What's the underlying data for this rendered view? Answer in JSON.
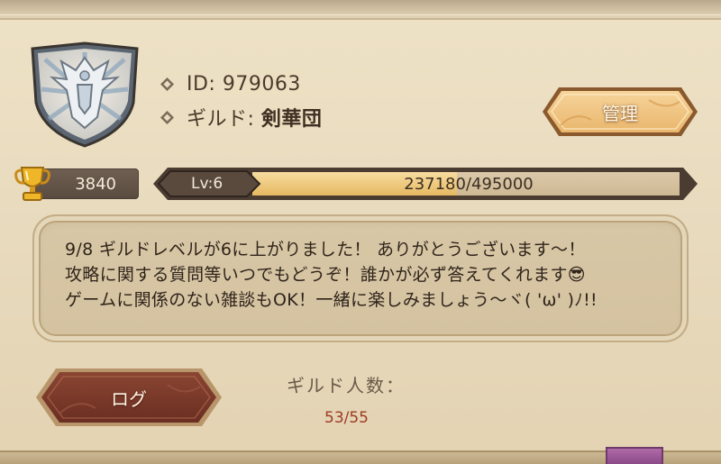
{
  "guild": {
    "id_label": "ID: 979063",
    "guild_prefix": "ギルド: ",
    "guild_name": "剣華団",
    "emblem_icon": "winged-helmet-shield-emblem"
  },
  "buttons": {
    "manage_label": "管理",
    "log_label": "ログ"
  },
  "trophy": {
    "icon": "trophy-icon",
    "value": "3840"
  },
  "level": {
    "label": "Lv:6",
    "xp_text": "237180/495000",
    "progress": 0.479
  },
  "message": {
    "lines": [
      "9/8  ギルドレベルが6に上がりました！ ありがとうございます〜！",
      "攻略に関する質問等いつでもどうぞ！誰かが必ず答えてくれます😎",
      "ゲームに関係のない雑談もOK！一緒に楽しみましょう〜ヾ( 'ω' )ﾉ!!"
    ]
  },
  "members": {
    "label": "ギルド人数：",
    "value": "53/55"
  },
  "colors": {
    "panel_bg": "#e9dcc0",
    "accent_gold": "#e7b75a",
    "member_count": "#9c3b23",
    "manage_button": "#efc58a",
    "log_button": "#7a3a2a"
  }
}
